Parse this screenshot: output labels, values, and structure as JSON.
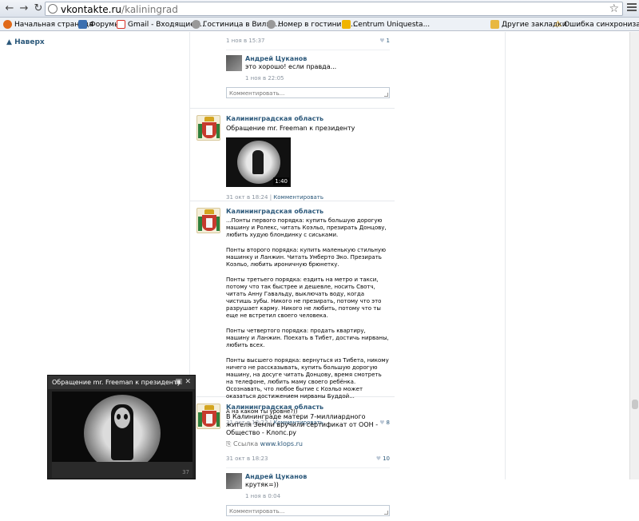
{
  "browser": {
    "url_host": "vkontakte.ru",
    "url_path": "/kaliningrad",
    "bookmarks": [
      {
        "label": "Начальная страница",
        "color": "#e06a1a"
      },
      {
        "label": "Форумы",
        "color": "#3b6fb0"
      },
      {
        "label": "Gmail - Входящие (...",
        "color": "#d93025"
      },
      {
        "label": "Гостиница в Вильн...",
        "color": "#777777"
      },
      {
        "label": "Номер в гостинице...",
        "color": "#777777"
      },
      {
        "label": "Centrum Uniquesta...",
        "color": "#f0b400"
      }
    ],
    "other_bookmarks": "Другие закладки",
    "sync_error": "Ошибка синхронизации"
  },
  "sidebar": {
    "back_to_top": "Наверх"
  },
  "feed": {
    "top_meta": "1 ноя в 15:37",
    "top_likes": "1",
    "top_comment": {
      "author": "Андрей Цуканов",
      "text": "это хорошо! если правда...",
      "time": "1 ноя в 22:05"
    },
    "comment_placeholder": "Комментировать...",
    "posts": [
      {
        "author": "Калининградская область",
        "text": "Обращение mr. Freeman к президенту",
        "video_duration": "1:40",
        "meta": "31 окт в 18:24",
        "comment_link": "Комментировать"
      },
      {
        "author": "Калининградская область",
        "paragraphs": [
          "...Понты первого порядка: купить большую дорогую машину и Ролекс, читать Коэльо, презирать Донцову, любить худую блондинку с сиськами.",
          "Понты второго порядка: купить маленькую стильную машинку и Ланжин. Читать Умберто Эко. Презирать Коэльо, любить ироничную брюнетку.",
          "Понты третьего порядка: ездить на метро и такси, потому что так быстрее и дешевле, носить Свотч, читать Анну Гавальду, выключать воду, когда чистишь зубы. Никого не презирать, потому что это разрушает карму. Никого не любить, потому что ты еще не встретил своего человека.",
          "Понты четвертого порядка: продать квартиру, машину и Ланжин. Поехать в Тибет, достичь нирваны, любить всех.",
          "Понты высшего порядка: вернуться из Тибета, никому ничего не рассказывать, купить большую дорогую машину, на досуге читать Донцову, время смотреть на телефоне, любить маму своего ребёнка. Осознавать, что любое бытие с Коэльо может оказаться достижением нирваны Буддой...",
          "А на каком ты уровне?))"
        ],
        "meta": "31 окт в 18:23",
        "comment_link": "Комментировать",
        "likes": "8"
      },
      {
        "author": "Калининградская область",
        "text": "В Калининграде матери 7-миллиардного жителя Земли вручили сертификат от ООН - Общество - Клопс.ру",
        "link_label": "Ссылка",
        "link_domain": "www.klops.ru",
        "meta": "31 окт в 18:23",
        "likes": "10",
        "comment": {
          "author": "Андрей Цуканов",
          "text": "крутяк=))",
          "time": "1 ноя в 0:04"
        }
      }
    ]
  },
  "mini_player": {
    "title": "Обращение mr. Freeman к президенту",
    "time": "37"
  }
}
